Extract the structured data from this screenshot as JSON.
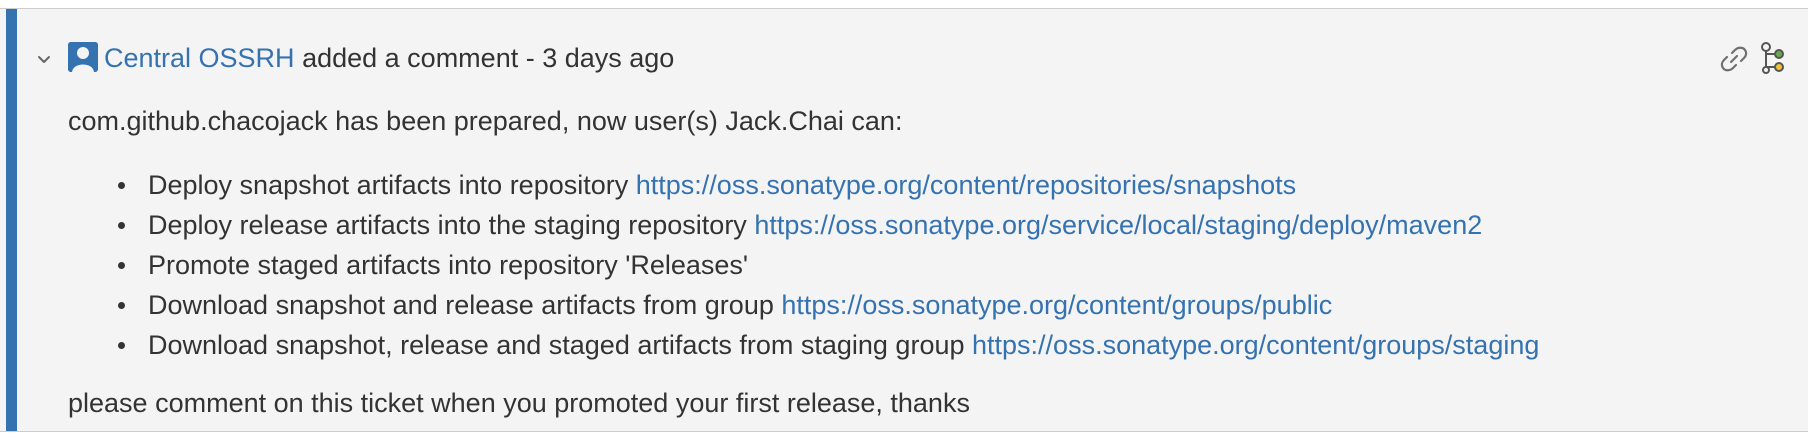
{
  "comment": {
    "author": "Central OSSRH",
    "action_text": "added a comment - 3 days ago",
    "intro": "com.github.chacojack has been prepared, now user(s) Jack.Chai can:",
    "items": [
      {
        "text": "Deploy snapshot artifacts into repository",
        "link": "https://oss.sonatype.org/content/repositories/snapshots"
      },
      {
        "text": "Deploy release artifacts into the staging repository",
        "link": "https://oss.sonatype.org/service/local/staging/deploy/maven2"
      },
      {
        "text": "Promote staged artifacts into repository 'Releases'",
        "link": ""
      },
      {
        "text": "Download snapshot and release artifacts from group",
        "link": "https://oss.sonatype.org/content/groups/public"
      },
      {
        "text": "Download snapshot, release and staged artifacts from staging group",
        "link": "https://oss.sonatype.org/content/groups/staging"
      }
    ],
    "outro": "please comment on this ticket when you promoted your first release, thanks"
  },
  "icons": {
    "toggle": "chevron-down-icon",
    "avatar": "user-avatar-icon",
    "permalink": "link-icon",
    "branch": "tree-icon"
  },
  "colors": {
    "accent": "#3572b0",
    "link": "#3572b0",
    "text": "#333333",
    "background": "#f4f4f4"
  }
}
